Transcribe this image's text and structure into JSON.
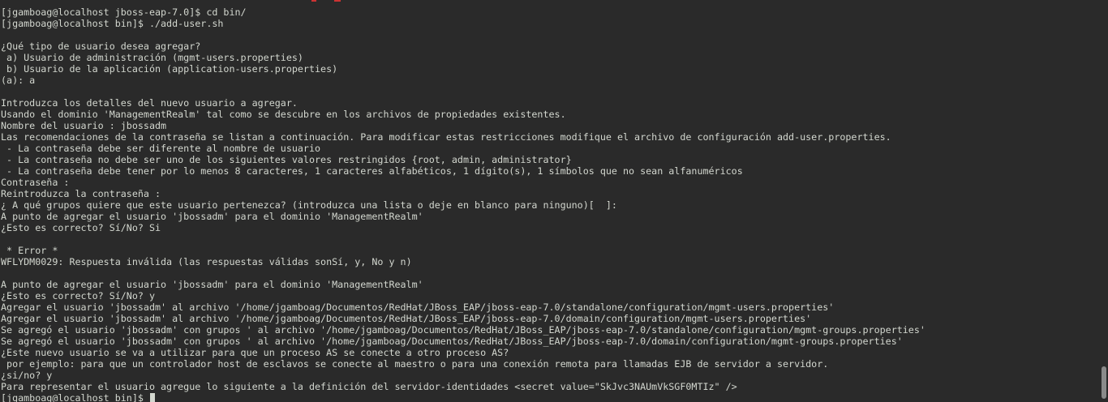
{
  "terminal": {
    "lines": [
      "",
      "[jgamboag@localhost jboss-eap-7.0]$ cd bin/",
      "[jgamboag@localhost bin]$ ./add-user.sh",
      "",
      "¿Qué tipo de usuario desea agregar?",
      " a) Usuario de administración (mgmt-users.properties)",
      " b) Usuario de la aplicación (application-users.properties)",
      "(a): a",
      "",
      "Introduzca los detalles del nuevo usuario a agregar.",
      "Usando el dominio 'ManagementRealm' tal como se descubre en los archivos de propiedades existentes.",
      "Nombre del usuario : jbossadm",
      "Las recomendaciones de la contraseña se listan a continuación. Para modificar estas restricciones modifique el archivo de configuración add-user.properties.",
      " - La contraseña debe ser diferente al nombre de usuario",
      " - La contraseña no debe ser uno de los siguientes valores restringidos {root, admin, administrator}",
      " - La contraseña debe tener por lo menos 8 caracteres, 1 caracteres alfabéticos, 1 dígito(s), 1 símbolos que no sean alfanuméricos",
      "Contraseña :",
      "Reintroduzca la contraseña :",
      "¿ A qué grupos quiere que este usuario pertenezca? (introduzca una lista o deje en blanco para ninguno)[  ]:",
      "A punto de agregar el usuario 'jbossadm' para el dominio 'ManagementRealm'",
      "¿Esto es correcto? Sí/No? Si",
      "",
      " * Error *",
      "WFLYDM0029: Respuesta inválida (las respuestas válidas sonSí, y, No y n)",
      "",
      "A punto de agregar el usuario 'jbossadm' para el dominio 'ManagementRealm'",
      "¿Esto es correcto? Sí/No? y",
      "Agregar el usuario 'jbossadm' al archivo '/home/jgamboag/Documentos/RedHat/JBoss_EAP/jboss-eap-7.0/standalone/configuration/mgmt-users.properties'",
      "Agregar el usuario 'jbossadm' al archivo '/home/jgamboag/Documentos/RedHat/JBoss_EAP/jboss-eap-7.0/domain/configuration/mgmt-users.properties'",
      "Se agregó el usuario 'jbossadm' con grupos ' al archivo '/home/jgamboag/Documentos/RedHat/JBoss_EAP/jboss-eap-7.0/standalone/configuration/mgmt-groups.properties'",
      "Se agregó el usuario 'jbossadm' con grupos ' al archivo '/home/jgamboag/Documentos/RedHat/JBoss_EAP/jboss-eap-7.0/domain/configuration/mgmt-groups.properties'",
      "¿Este nuevo usuario se va a utilizar para que un proceso AS se conecte a otro proceso AS?",
      " por ejemplo: para que un controlador host de esclavos se conecte al maestro o para una conexión remota para llamadas EJB de servidor a servidor.",
      "¿si/no? y",
      "Para representar el usuario agregue lo siguiente a la definición del servidor-identidades <secret value=\"SkJvc3NAUmVkSGF0MTIz\" />"
    ],
    "prompt": "[jgamboag@localhost bin]$ "
  },
  "colors": {
    "background": "#2a2a2a",
    "foreground": "#d3d7cf",
    "scrollbar_thumb": "#8a8a8a",
    "error_accent": "#cc3333"
  },
  "icons": {
    "cursor": "block-cursor-icon"
  }
}
